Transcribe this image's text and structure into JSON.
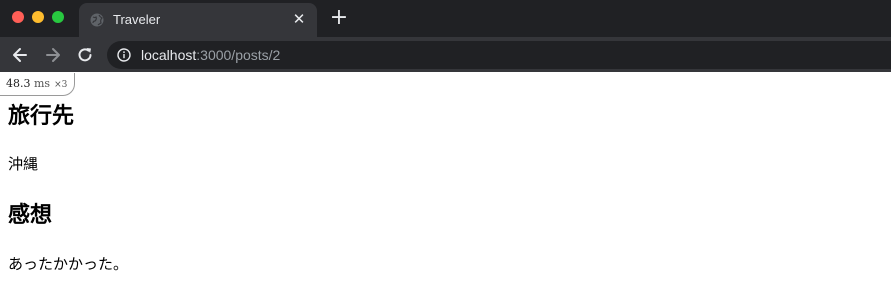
{
  "browser": {
    "tab_title": "Traveler",
    "url_host": "localhost",
    "url_rest": ":3000/posts/2"
  },
  "profiler": {
    "time_value": "48.3",
    "time_unit": "ms",
    "count": "×3"
  },
  "post": {
    "destination_heading": "旅行先",
    "destination": "沖縄",
    "impression_heading": "感想",
    "impression": "あったかかった。"
  }
}
